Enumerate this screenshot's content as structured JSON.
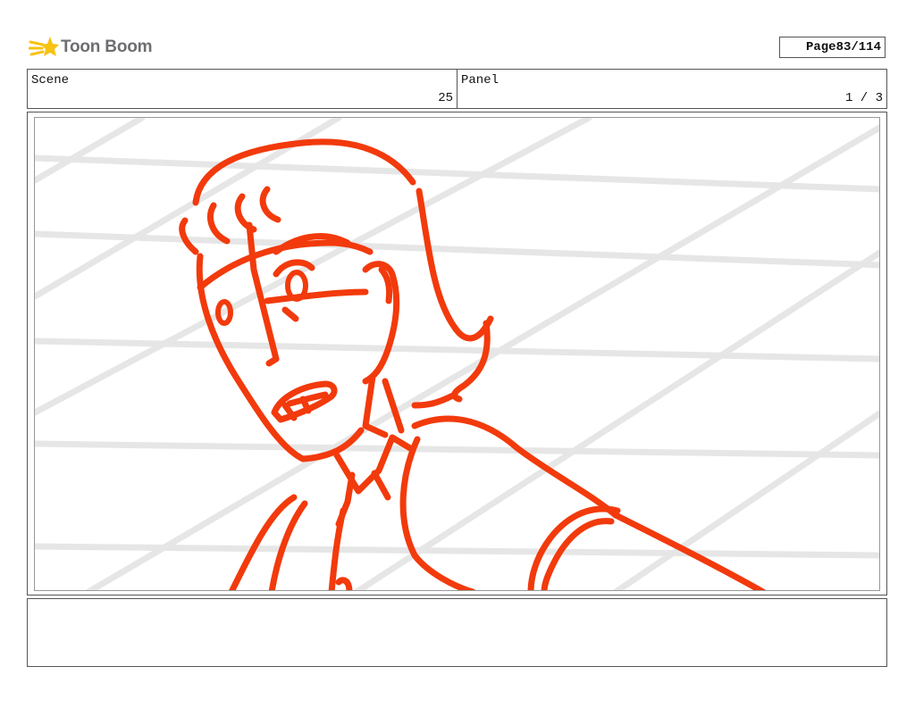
{
  "header": {
    "logo_text": "Toon Boom",
    "logo_icon": "comet-star-icon",
    "page_label": "Page",
    "page_value": "83/114"
  },
  "info": {
    "scene_label": "Scene",
    "scene_value": "25",
    "panel_label": "Panel",
    "panel_value": "1 / 3"
  },
  "panel": {
    "sketch_color": "#f23a0c",
    "grid_color": "#e6e6e6"
  },
  "notes": {
    "text": ""
  }
}
